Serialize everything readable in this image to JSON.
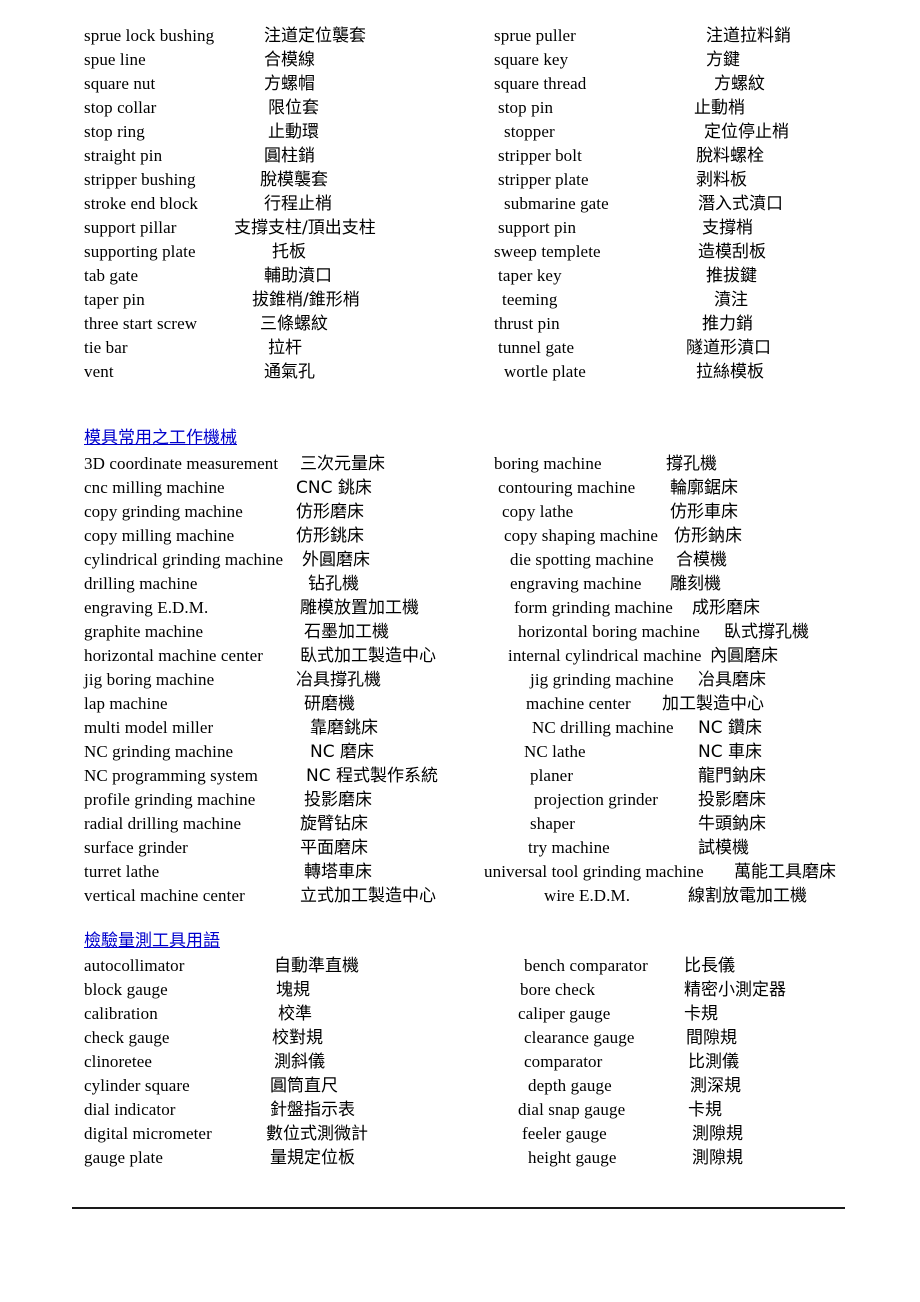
{
  "document": {
    "language_pair": "English - Traditional Chinese",
    "sections": [
      {
        "id": "mold-parts-continued",
        "heading": null,
        "left_entries": [
          {
            "en": "sprue lock bushing",
            "zh": "注道定位襲套"
          },
          {
            "en": "spue line",
            "zh": "合模線"
          },
          {
            "en": "square nut",
            "zh": "方螺帽"
          },
          {
            "en": "stop collar",
            "zh": "限位套"
          },
          {
            "en": "stop ring",
            "zh": "止動環"
          },
          {
            "en": "straight pin",
            "zh": "圓柱銷"
          },
          {
            "en": "stripper bushing",
            "zh": "脫模襲套"
          },
          {
            "en": "stroke end block",
            "zh": "行程止梢"
          },
          {
            "en": "support pillar",
            "zh": "支撐支柱/頂出支柱"
          },
          {
            "en": "supporting plate",
            "zh": "托板"
          },
          {
            "en": "tab gate",
            "zh": "輔助濆口"
          },
          {
            "en": "taper pin",
            "zh": "拔錐梢/錐形梢"
          },
          {
            "en": "three start screw",
            "zh": "三條螺紋"
          },
          {
            "en": "tie bar",
            "zh": "拉杆"
          },
          {
            "en": "vent",
            "zh": "通氣孔"
          }
        ],
        "right_entries": [
          {
            "en": "sprue puller",
            "zh": "注道拉料銷"
          },
          {
            "en": "square key",
            "zh": "方鍵"
          },
          {
            "en": "square thread",
            "zh": "方螺紋"
          },
          {
            "en": "stop pin",
            "zh": "止動梢"
          },
          {
            "en": "stopper",
            "zh": "定位停止梢"
          },
          {
            "en": "stripper bolt",
            "zh": "脫料螺栓"
          },
          {
            "en": "stripper plate",
            "zh": "剥料板"
          },
          {
            "en": "submarine gate",
            "zh": "潛入式濆口"
          },
          {
            "en": "support pin",
            "zh": "支撐梢"
          },
          {
            "en": "sweep templete",
            "zh": "造模刮板"
          },
          {
            "en": "taper key",
            "zh": "推拔鍵"
          },
          {
            "en": "teeming",
            "zh": "濆注"
          },
          {
            "en": "thrust pin",
            "zh": "推力銷"
          },
          {
            "en": "tunnel gate",
            "zh": "隧道形濆口"
          },
          {
            "en": "wortle plate",
            "zh": "拉絲模板"
          }
        ]
      },
      {
        "id": "machine-tools",
        "heading": "模具常用之工作機械",
        "left_entries": [
          {
            "en": "3D coordinate measurement",
            "zh": "三次元量床"
          },
          {
            "en": "cnc milling machine",
            "zh": "CNC 銚床"
          },
          {
            "en": "copy grinding machine",
            "zh": "仿形磨床"
          },
          {
            "en": "copy milling machine",
            "zh": "仿形銚床"
          },
          {
            "en": "cylindrical grinding machine",
            "zh": "外圓磨床"
          },
          {
            "en": "drilling machine",
            "zh": "钻孔機"
          },
          {
            "en": "engraving E.D.M.",
            "zh": "雕模放置加工機"
          },
          {
            "en": "graphite machine",
            "zh": "石墨加工機"
          },
          {
            "en": "horizontal machine center",
            "zh": "臥式加工製造中心"
          },
          {
            "en": "jig boring machine",
            "zh": "冶具撐孔機"
          },
          {
            "en": "lap machine",
            "zh": "研磨機"
          },
          {
            "en": "multi model miller",
            "zh": "靠磨銚床"
          },
          {
            "en": "NC grinding machine",
            "zh": "NC 磨床"
          },
          {
            "en": "NC programming system",
            "zh": "NC 程式製作系統"
          },
          {
            "en": "profile grinding machine",
            "zh": "投影磨床"
          },
          {
            "en": "radial drilling machine",
            "zh": "旋臂钻床"
          },
          {
            "en": "surface grinder",
            "zh": "平面磨床"
          },
          {
            "en": "turret lathe",
            "zh": "轉塔車床"
          },
          {
            "en": "vertical machine center",
            "zh": "立式加工製造中心"
          }
        ],
        "right_entries": [
          {
            "en": "boring machine",
            "zh": "撐孔機"
          },
          {
            "en": "contouring machine",
            "zh": "輪廓鋸床"
          },
          {
            "en": "copy lathe",
            "zh": "仿形車床"
          },
          {
            "en": "copy shaping machine",
            "zh": "仿形鈉床"
          },
          {
            "en": "die spotting machine",
            "zh": "合模機"
          },
          {
            "en": "engraving machine",
            "zh": "雕刻機"
          },
          {
            "en": "form grinding machine",
            "zh": "成形磨床"
          },
          {
            "en": "horizontal boring machine",
            "zh": "臥式撐孔機"
          },
          {
            "en": "internal cylindrical machine",
            "zh": "內圓磨床"
          },
          {
            "en": "jig grinding machine",
            "zh": "冶具磨床"
          },
          {
            "en": "machine center",
            "zh": "加工製造中心"
          },
          {
            "en": "NC drilling machine",
            "zh": "NC 鑽床"
          },
          {
            "en": "NC lathe",
            "zh": "NC 車床"
          },
          {
            "en": "planer",
            "zh": "龍門鈉床"
          },
          {
            "en": "projection grinder",
            "zh": "投影磨床"
          },
          {
            "en": "shaper",
            "zh": "牛頭鈉床"
          },
          {
            "en": "try machine",
            "zh": "試模機"
          },
          {
            "en": "universal tool grinding machine",
            "zh": "萬能工具磨床"
          },
          {
            "en": "wire E.D.M.",
            "zh": "線割放電加工機"
          }
        ]
      },
      {
        "id": "measuring-tools",
        "heading": "檢驗量測工具用語",
        "left_entries": [
          {
            "en": "autocollimator",
            "zh": "自動準直機"
          },
          {
            "en": "block gauge",
            "zh": "塊規"
          },
          {
            "en": "calibration",
            "zh": "校準"
          },
          {
            "en": "check gauge",
            "zh": "校對規"
          },
          {
            "en": "clinoretee",
            "zh": "測斜儀"
          },
          {
            "en": "cylinder square",
            "zh": "圓筒直尺"
          },
          {
            "en": "dial indicator",
            "zh": "針盤指示表"
          },
          {
            "en": "digital micrometer",
            "zh": "數位式測微計"
          },
          {
            "en": "gauge plate",
            "zh": "量規定位板"
          }
        ],
        "right_entries": [
          {
            "en": "bench comparator",
            "zh": "比長儀"
          },
          {
            "en": "bore check",
            "zh": "精密小測定器"
          },
          {
            "en": "caliper gauge",
            "zh": "卡規"
          },
          {
            "en": "clearance gauge",
            "zh": "間隙規"
          },
          {
            "en": "comparator",
            "zh": "比測儀"
          },
          {
            "en": "depth gauge",
            "zh": "測深規"
          },
          {
            "en": "dial snap gauge",
            "zh": "卡規"
          },
          {
            "en": "feeler gauge",
            "zh": "測隙規"
          },
          {
            "en": "height gauge",
            "zh": "測隙規"
          }
        ]
      }
    ],
    "colors": {
      "heading_link": "#0000cc",
      "body_text": "#000000",
      "rule": "#1a1a1a",
      "background": "#ffffff"
    }
  }
}
